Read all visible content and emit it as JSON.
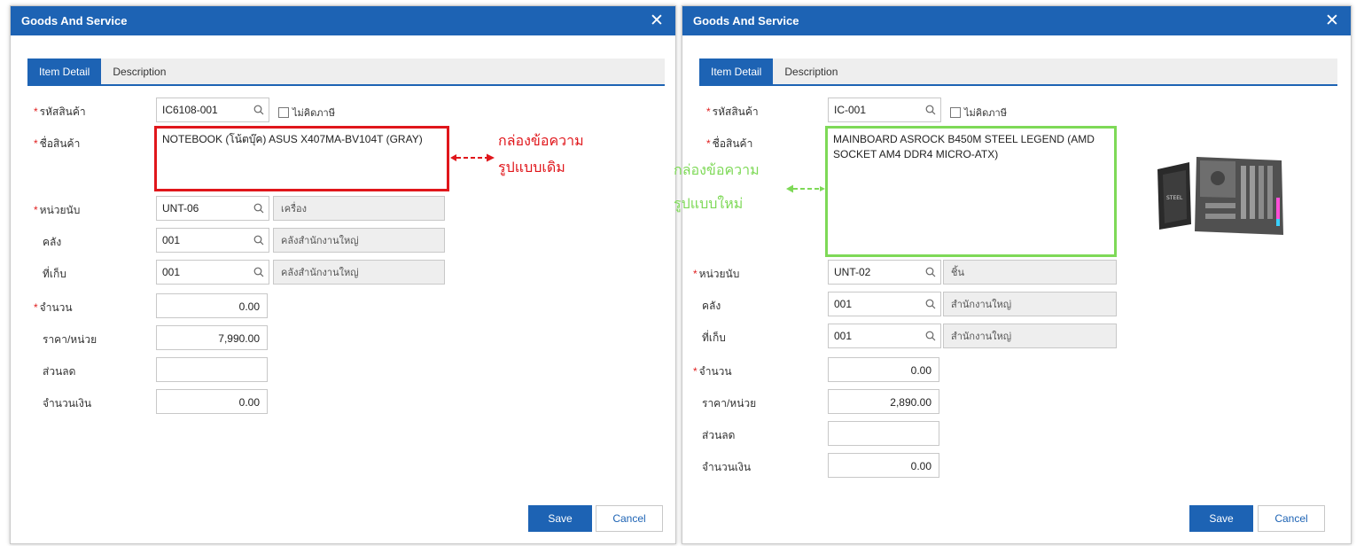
{
  "dialogs": {
    "left": {
      "title": "Goods And Service",
      "tabs": [
        "Item Detail",
        "Description"
      ],
      "fields": {
        "code_label": "รหัสสินค้า",
        "code_value": "IC6108-001",
        "no_tax_label": "ไม่คิดภาษี",
        "name_label": "ชื่อสินค้า",
        "name_value": "NOTEBOOK (โน้ตบุ๊ค) ASUS X407MA-BV104T (GRAY)",
        "unit_label": "หน่วยนับ",
        "unit_code": "UNT-06",
        "unit_desc": "เครื่อง",
        "warehouse_label": "คลัง",
        "warehouse_code": "001",
        "warehouse_desc": "คลังสำนักงานใหญ่",
        "location_label": "ที่เก็บ",
        "location_code": "001",
        "location_desc": "คลังสำนักงานใหญ่",
        "qty_label": "จำนวน",
        "qty_value": "0.00",
        "price_label": "ราคา/หน่วย",
        "price_value": "7,990.00",
        "discount_label": "ส่วนลด",
        "discount_value": "",
        "amount_label": "จำนวนเงิน",
        "amount_value": "0.00"
      },
      "save_label": "Save",
      "cancel_label": "Cancel"
    },
    "right": {
      "title": "Goods And Service",
      "tabs": [
        "Item Detail",
        "Description"
      ],
      "fields": {
        "code_label": "รหัสสินค้า",
        "code_value": "IC-001",
        "no_tax_label": "ไม่คิดภาษี",
        "name_label": "ชื่อสินค้า",
        "name_value": "MAINBOARD ASROCK B450M STEEL LEGEND (AMD SOCKET AM4 DDR4 MICRO-ATX)",
        "unit_label": "หน่วยนับ",
        "unit_code": "UNT-02",
        "unit_desc": "ชิ้น",
        "warehouse_label": "คลัง",
        "warehouse_code": "001",
        "warehouse_desc": "สำนักงานใหญ่",
        "location_label": "ที่เก็บ",
        "location_code": "001",
        "location_desc": "สำนักงานใหญ่",
        "qty_label": "จำนวน",
        "qty_value": "0.00",
        "price_label": "ราคา/หน่วย",
        "price_value": "2,890.00",
        "discount_label": "ส่วนลด",
        "discount_value": "",
        "amount_label": "จำนวนเงิน",
        "amount_value": "0.00"
      },
      "save_label": "Save",
      "cancel_label": "Cancel",
      "image_icon": "motherboard-product-image"
    }
  },
  "annotations": {
    "old_line1": "กล่องข้อความ",
    "old_line2": "รูปแบบเดิม",
    "new_line1": "กล่องข้อความ",
    "new_line2": "รูปแบบใหม่",
    "old_color": "#e0161b",
    "new_color": "#7ed957"
  },
  "colors": {
    "primary": "#1d63b4",
    "required": "#e02020"
  }
}
